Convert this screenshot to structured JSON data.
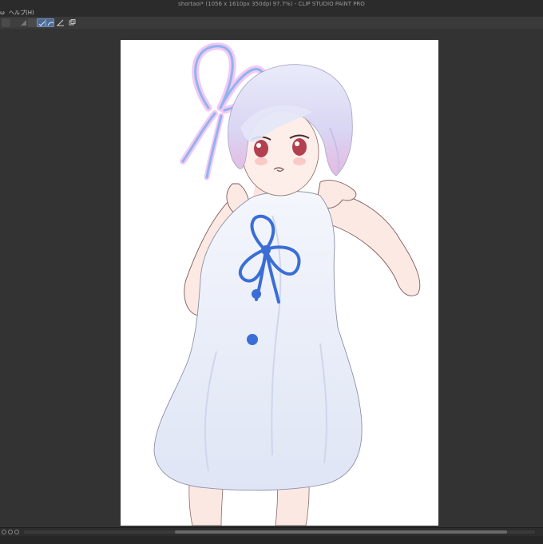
{
  "window": {
    "title": "shortaoi* (1056 x 1610px 350dpi 97.7%)  - CLIP STUDIO PAINT PRO"
  },
  "menu": {
    "prev_fragment": "ω",
    "help": "ヘルプ(H)"
  },
  "toolbar": {
    "buttons": [
      {
        "name": "tool-1-button",
        "icon": "square-icon"
      },
      {
        "name": "tool-2-button",
        "icon": "square-icon"
      },
      {
        "name": "tool-3-button",
        "icon": "triangle-icon"
      },
      {
        "name": "tool-4-button",
        "icon": "square-icon"
      },
      {
        "name": "snap-ruler-button",
        "icon": "ruler-check-icon",
        "active": true
      },
      {
        "name": "snap-special-ruler-button",
        "icon": "ruler-curve-icon",
        "active": true
      },
      {
        "name": "snap-grid-button",
        "icon": "pen-line-icon"
      },
      {
        "name": "layer-button",
        "icon": "layer-icon"
      }
    ]
  },
  "canvas": {
    "background": "#ffffff",
    "artwork": "illustration of a girl with short lavender hair in a white sleeveless dress with a blue ribbon"
  },
  "colors": {
    "workspace": "#333333",
    "chrome": "#2b2b2b",
    "accent": "#4f6a92",
    "ribbon": "#3a6ed6"
  }
}
